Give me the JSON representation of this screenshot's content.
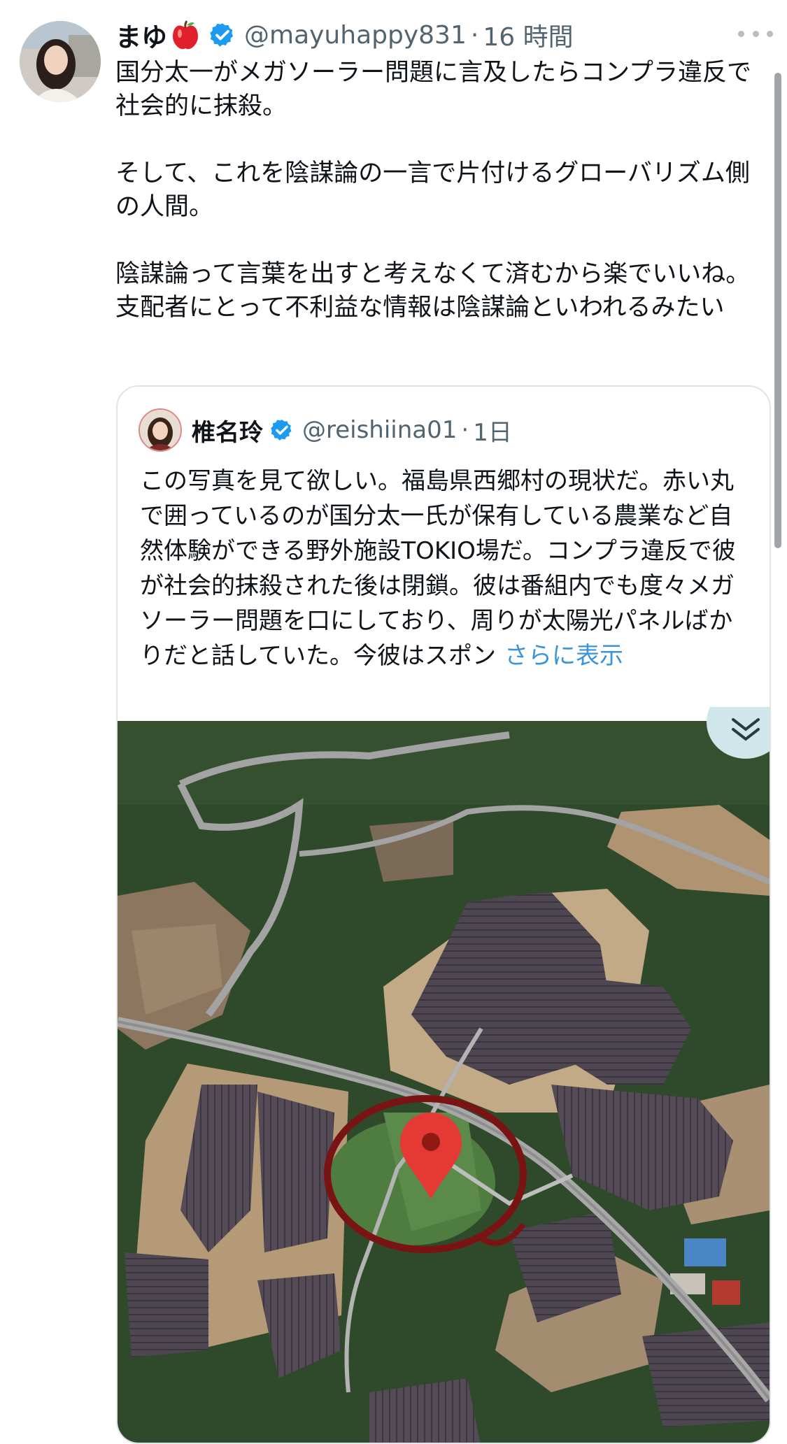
{
  "tweet": {
    "display_name": "まゆ",
    "name_emoji": "apple-emoji",
    "verified_icon": "verified-badge-icon",
    "handle": "@mayuhappy831",
    "separator": "·",
    "time": "16 時間",
    "more_icon": "more-icon",
    "paragraphs": [
      "国分太一がメガソーラー問題に言及したらコンプラ違反で社会的に抹殺。",
      "そして、これを陰謀論の一言で片付けるグローバリズム側の人間。",
      "陰謀論って言葉を出すと考えなくて済むから楽でいいね。支配者にとって不利益な情報は陰謀論といわれるみたい"
    ]
  },
  "quoted": {
    "display_name": "椎名玲",
    "handle": "@reishiina01",
    "separator": "·",
    "time": "1日",
    "text": "この写真を見て欲しい。福島県西郷村の現状だ。赤い丸で囲っているのが国分太一氏が保有している農業など自然体験ができる野外施設TOKIO場だ。コンプラ違反で彼が社会的抹殺された後は閉鎖。彼は番組内でも度々メガソーラー問題を口にしており、周りが太陽光パネルばかりだと話していた。今彼はスポン",
    "show_more": "さらに表示",
    "collapse_icon": "chevron-down-double-icon"
  },
  "colors": {
    "text": "#0f1419",
    "secondary": "#536471",
    "link": "#3b94d9",
    "verified": "#1d9bf0",
    "pin": "#e53935",
    "circle": "#7a1414"
  }
}
